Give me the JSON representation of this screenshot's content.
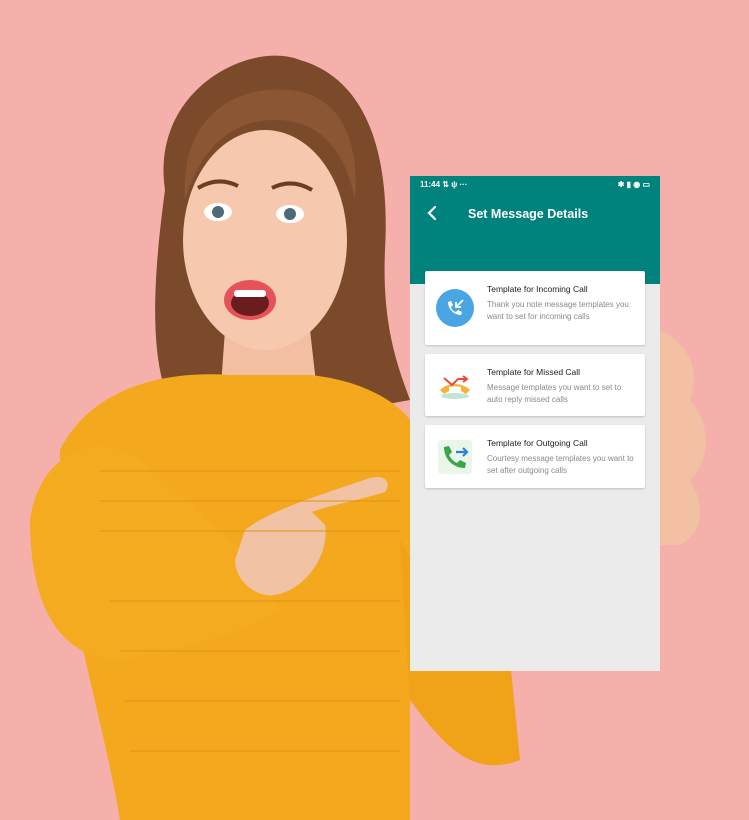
{
  "status_bar": {
    "time": "11:44",
    "left_icons": "⇅ ψ ···",
    "right_icons": "✱ ▮ ◉ ▭"
  },
  "header": {
    "title": "Set Message Details",
    "back_icon": "back-arrow-icon"
  },
  "templates": [
    {
      "title": "Template for Incoming Call",
      "description": "Thank you note message templates you want to set for incoming calls",
      "icon": "incoming-call-icon",
      "color": "#4aa6e3"
    },
    {
      "title": "Template for Missed Call",
      "description": "Message templates you want to set to auto reply missed calls",
      "icon": "missed-call-icon",
      "color": "#e84b3c"
    },
    {
      "title": "Template for Outgoing Call",
      "description": "Courtesy message templates you want to set after outgoing calls",
      "icon": "outgoing-call-icon",
      "color": "#3aa54a"
    }
  ],
  "colors": {
    "background": "#f6b0ab",
    "appbar": "#00837c",
    "sweater": "#f3a81d"
  }
}
